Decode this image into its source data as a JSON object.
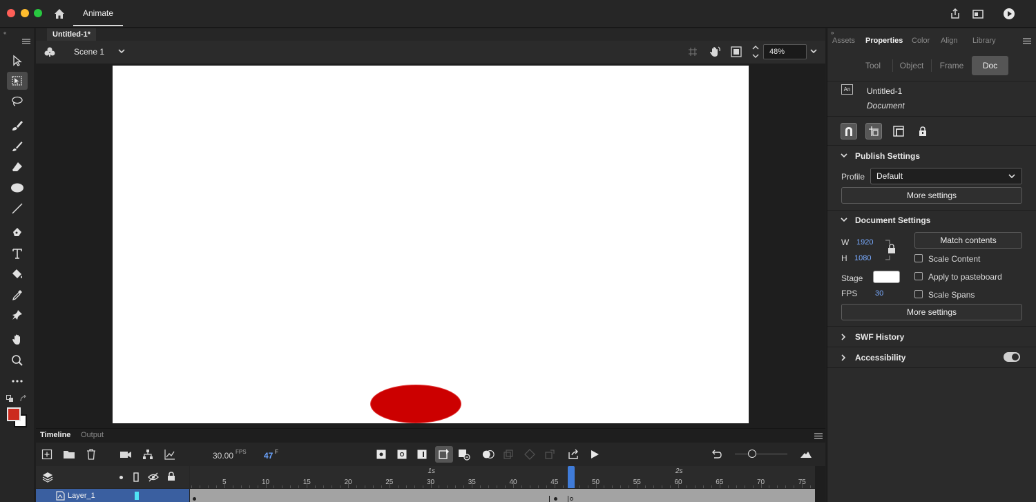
{
  "titlebar": {
    "app_tab": "Animate"
  },
  "document": {
    "tab_title": "Untitled-1*",
    "scene": "Scene 1",
    "zoom": "48%"
  },
  "timeline": {
    "tabs": [
      "Timeline",
      "Output"
    ],
    "fps_value": "30.00",
    "fps_unit": "FPS",
    "current_frame": "47",
    "frame_unit": "F",
    "ruler": {
      "ticks": [
        5,
        10,
        15,
        20,
        25,
        30,
        35,
        40,
        45,
        50,
        55,
        60,
        65,
        70,
        75
      ],
      "seconds": [
        "1s",
        "2s"
      ]
    },
    "layer": {
      "name": "Layer_1"
    }
  },
  "panel": {
    "tabs": [
      "Assets",
      "Properties",
      "Color",
      "Align",
      "Library"
    ],
    "active_tab": "Properties",
    "subtabs": [
      "Tool",
      "Object",
      "Frame",
      "Doc"
    ],
    "active_subtab": "Doc",
    "doc_badge": "An",
    "doc_name": "Untitled-1",
    "doc_type": "Document",
    "publish": {
      "title": "Publish Settings",
      "profile_label": "Profile",
      "profile_value": "Default",
      "more_settings": "More settings"
    },
    "doc_settings": {
      "title": "Document Settings",
      "w_label": "W",
      "w_value": "1920",
      "h_label": "H",
      "h_value": "1080",
      "match_contents": "Match contents",
      "scale_content": "Scale Content",
      "stage_label": "Stage",
      "stage_color": "#ffffff",
      "apply_pasteboard": "Apply to pasteboard",
      "fps_label": "FPS",
      "fps_value": "30",
      "scale_spans": "Scale Spans",
      "more_settings": "More settings"
    },
    "swf_history": "SWF History",
    "accessibility": "Accessibility"
  },
  "colors": {
    "stroke": "#cc2a1e",
    "fill": "#ffffff",
    "ellipse": "#cc0000",
    "accent": "#3f7bd8"
  }
}
